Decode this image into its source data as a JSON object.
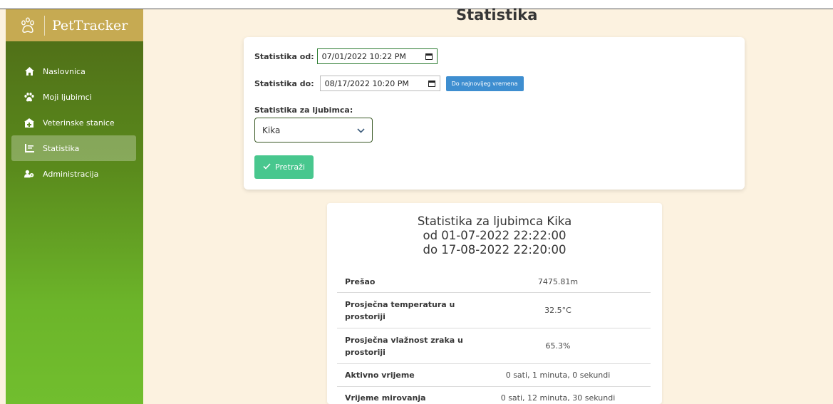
{
  "sidebar": {
    "brand": "PetTracker",
    "items": [
      {
        "label": "Naslovnica",
        "icon": "home-icon"
      },
      {
        "label": "Moji ljubimci",
        "icon": "paw-icon"
      },
      {
        "label": "Veterinske stanice",
        "icon": "clinic-icon"
      },
      {
        "label": "Statistika",
        "icon": "chart-icon",
        "active": true
      },
      {
        "label": "Administracija",
        "icon": "users-icon"
      }
    ]
  },
  "page": {
    "title": "Statistika"
  },
  "form": {
    "from_label": "Statistika od:",
    "from_value": "07/01/2022 10:22 PM",
    "to_label": "Statistika do:",
    "to_value": "08/17/2022 10:20 PM",
    "latest_button": "Do najnovijeg vremena",
    "pet_label": "Statistika za ljubimca:",
    "pet_value": "Kika",
    "search_button": "Pretraži"
  },
  "stats": {
    "title_line1": "Statistika za ljubimca Kika",
    "title_line2": "od 01-07-2022 22:22:00",
    "title_line3": "do 17-08-2022 22:20:00",
    "rows": [
      {
        "key": "Prešao",
        "value": "7475.81m"
      },
      {
        "key": "Prosječna temperatura u prostoriji",
        "value": "32.5°C"
      },
      {
        "key": "Prosječna vlažnost zraka u prostoriji",
        "value": "65.3%"
      },
      {
        "key": "Aktivno vrijeme",
        "value": "0 sati, 1 minuta, 0 sekundi"
      },
      {
        "key": "Vrijeme mirovanja",
        "value": "0 sati, 12 minuta, 30 sekundi"
      }
    ]
  },
  "colors": {
    "brand_bar": "#c6aa52",
    "sidebar_top": "#4e6a17",
    "sidebar_bottom": "#71be2e",
    "page_bg": "#fcf2e0",
    "search_button": "#48c78e",
    "latest_button": "#3e8ed0"
  }
}
